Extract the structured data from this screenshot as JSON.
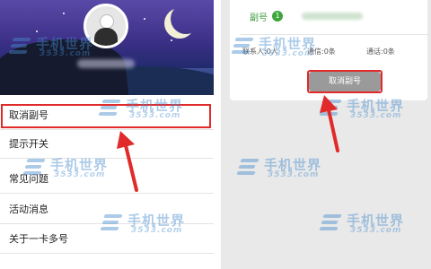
{
  "left_panel": {
    "menu": [
      {
        "label": "取消副号"
      },
      {
        "label": "提示开关"
      },
      {
        "label": "常见问题"
      },
      {
        "label": "活动消息"
      },
      {
        "label": "关于一卡多号"
      }
    ]
  },
  "right_panel": {
    "subno_label": "副号",
    "subno_badge": "1",
    "stats": [
      "联系人:0人",
      "通信:0条",
      "通话:0条"
    ],
    "cancel_button": "取消副号"
  },
  "watermark": {
    "title": "手机世界",
    "site": "3533.com"
  },
  "colors": {
    "highlight": "#e12a2a",
    "accent_green": "#3da63d",
    "watermark_blue": "#468ccd"
  }
}
